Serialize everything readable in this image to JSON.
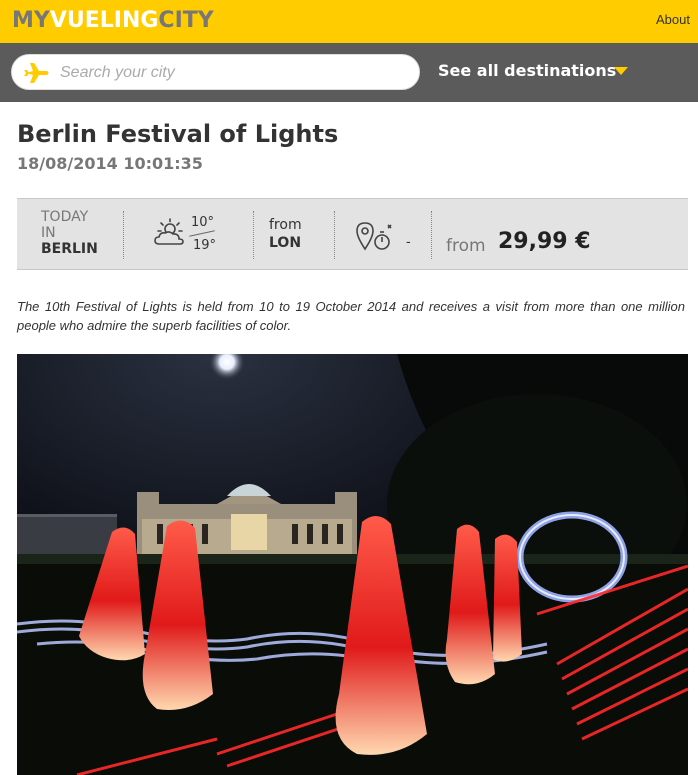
{
  "header": {
    "logo_part1": "MY",
    "logo_part2": "VUELING",
    "logo_part3": "CITY",
    "about_label": "About"
  },
  "search": {
    "placeholder": "Search your city",
    "value": "",
    "destinations_label": "See all destinations"
  },
  "article": {
    "title": "Berlin Festival of Lights",
    "datetime": "18/08/2014 10:01:35",
    "description": "The 10th Festival of Lights is held from 10 to 19 October 2014 and receives a visit from more than one million people who admire the superb facilities of color."
  },
  "info": {
    "today_line1": "TODAY",
    "today_line2": "IN",
    "city": "BERLIN",
    "temp_high": "10°",
    "temp_low": "19°",
    "from_label": "from",
    "from_city": "LON",
    "flight_time": "-",
    "price_from_label": "from",
    "price": "29,99 €"
  },
  "colors": {
    "brand_yellow": "#ffcc00",
    "search_bar_gray": "#5b5b5b",
    "info_bar_gray": "#e3e3e3"
  },
  "icons": [
    "plane-icon",
    "chevron-down-icon",
    "weather-sun-cloud-icon",
    "map-pin-stopwatch-icon"
  ]
}
